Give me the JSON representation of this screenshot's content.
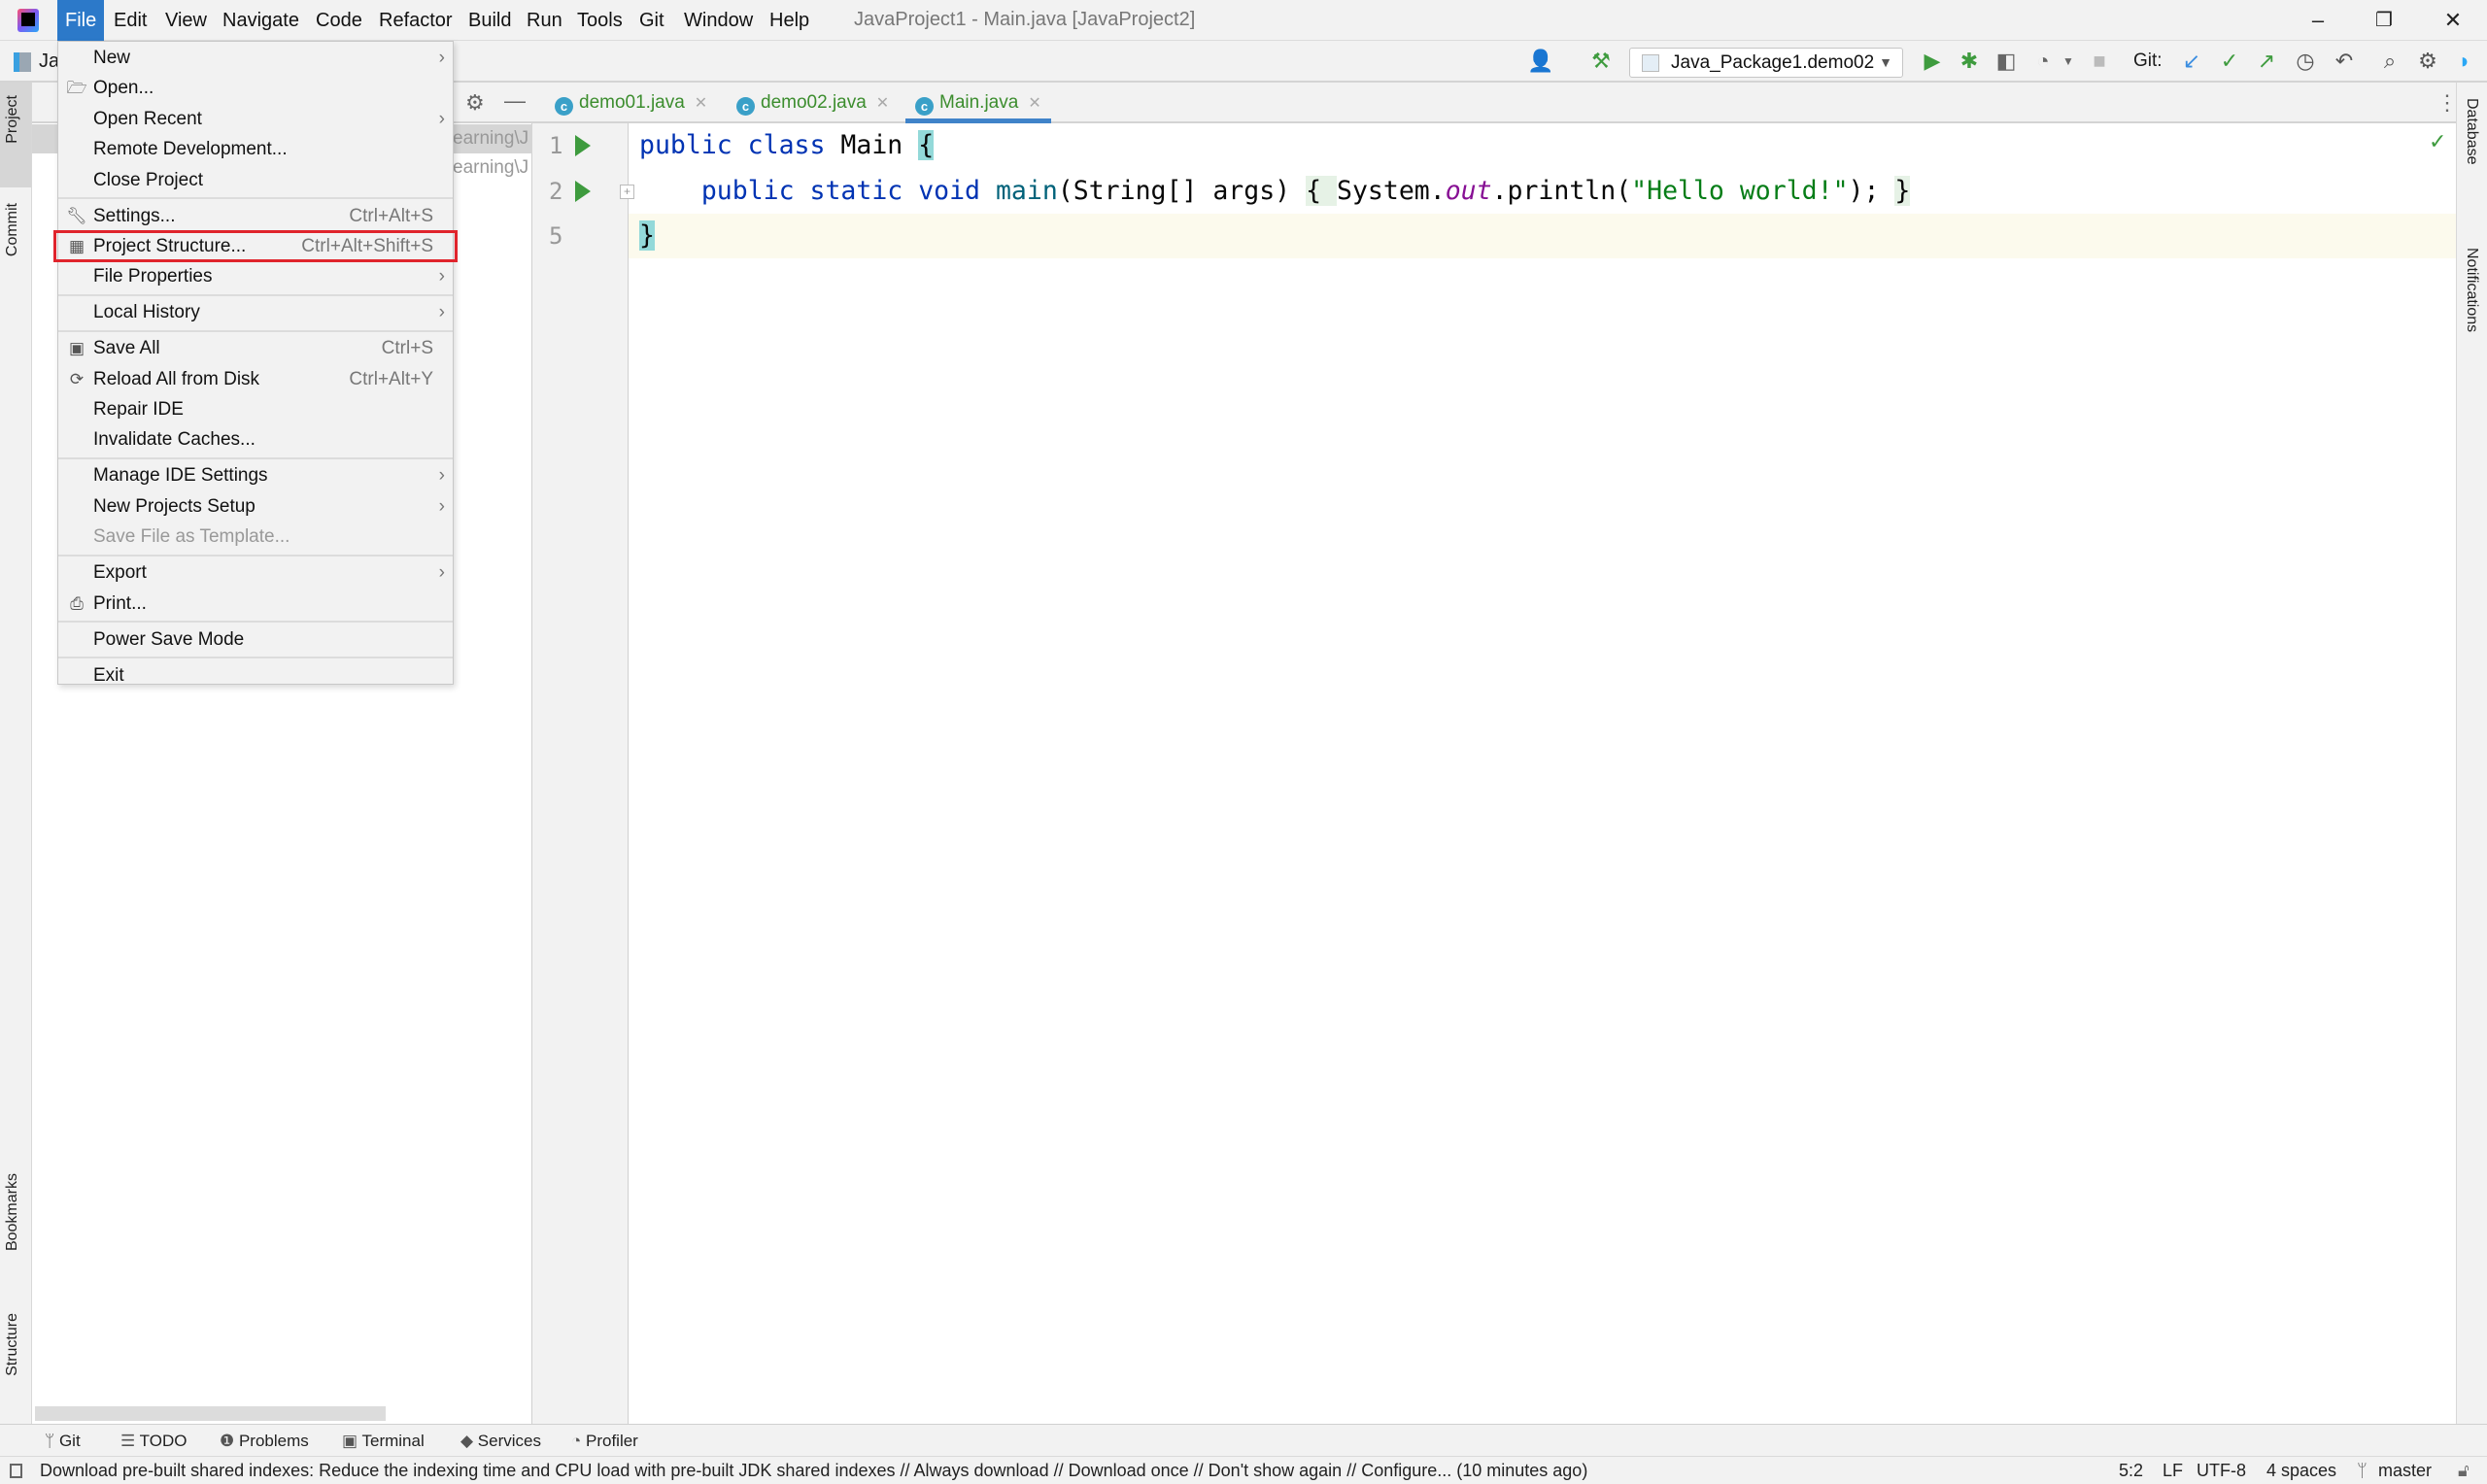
{
  "app": {
    "title": "JavaProject1 - Main.java [JavaProject2]",
    "logo_text": "IJ"
  },
  "menubar": [
    "File",
    "Edit",
    "View",
    "Navigate",
    "Code",
    "Refactor",
    "Build",
    "Run",
    "Tools",
    "Git",
    "Window",
    "Help"
  ],
  "window_controls": {
    "minimize": "–",
    "restore": "❐",
    "close": "✕"
  },
  "toolbar": {
    "project_label": "Ja",
    "run_config": "Java_Package1.demo02",
    "git_label": "Git:",
    "icons": [
      "user-icon",
      "hammer-icon",
      "run-icon",
      "debug-icon",
      "coverage-icon",
      "profile-icon",
      "stop-icon",
      "git-update-icon",
      "git-commit-icon",
      "git-push-icon",
      "history-icon",
      "rollback-icon",
      "search-icon",
      "settings-icon",
      "plugin-icon"
    ]
  },
  "left_stripe": [
    "Project",
    "Commit",
    "Bookmarks",
    "Structure"
  ],
  "right_stripe": [
    "Database",
    "Notifications"
  ],
  "project_panel": {
    "rows": [
      "earning\\J",
      "earning\\J"
    ]
  },
  "tabs": [
    {
      "label": "demo01.java",
      "active": false
    },
    {
      "label": "demo02.java",
      "active": false
    },
    {
      "label": "Main.java",
      "active": true
    }
  ],
  "colors": {
    "accent": "#2c79c9",
    "tab_text": "#3c8d2e",
    "keyword": "#0033b3",
    "string": "#067d17",
    "highlight_box": "#e0242c"
  },
  "code": [
    {
      "num": "1",
      "run": true,
      "tokens": [
        {
          "t": "public class ",
          "c": "kw"
        },
        {
          "t": "Main ",
          "c": ""
        },
        {
          "t": "{",
          "c": "hlc"
        }
      ]
    },
    {
      "num": "2",
      "run": true,
      "tokens": [
        {
          "t": "    ",
          "c": ""
        },
        {
          "t": "public static void ",
          "c": "kw"
        },
        {
          "t": "main",
          "c": "fn"
        },
        {
          "t": "(String[] args) ",
          "c": ""
        },
        {
          "t": "{ ",
          "c": "hlf"
        },
        {
          "t": "System.",
          "c": ""
        },
        {
          "t": "out",
          "c": "it"
        },
        {
          "t": ".println(",
          "c": ""
        },
        {
          "t": "\"Hello world!\"",
          "c": "st"
        },
        {
          "t": "); ",
          "c": ""
        },
        {
          "t": "}",
          "c": "hlf"
        }
      ]
    },
    {
      "num": "5",
      "run": false,
      "tokens": [
        {
          "t": "}",
          "c": "hlc"
        }
      ]
    }
  ],
  "file_menu": [
    {
      "label": "New",
      "submenu": true
    },
    {
      "label": "Open...",
      "icon": "folder-icon"
    },
    {
      "label": "Open Recent",
      "submenu": true
    },
    {
      "label": "Remote Development..."
    },
    {
      "label": "Close Project"
    },
    {
      "sep": true
    },
    {
      "label": "Settings...",
      "shortcut": "Ctrl+Alt+S",
      "icon": "wrench-icon"
    },
    {
      "label": "Project Structure...",
      "shortcut": "Ctrl+Alt+Shift+S",
      "icon": "project-structure-icon",
      "highlighted": true
    },
    {
      "label": "File Properties",
      "submenu": true
    },
    {
      "sep": true
    },
    {
      "label": "Local History",
      "submenu": true
    },
    {
      "sep": true
    },
    {
      "label": "Save All",
      "shortcut": "Ctrl+S",
      "icon": "save-icon"
    },
    {
      "label": "Reload All from Disk",
      "shortcut": "Ctrl+Alt+Y",
      "icon": "reload-icon"
    },
    {
      "label": "Repair IDE"
    },
    {
      "label": "Invalidate Caches..."
    },
    {
      "sep": true
    },
    {
      "label": "Manage IDE Settings",
      "submenu": true
    },
    {
      "label": "New Projects Setup",
      "submenu": true
    },
    {
      "label": "Save File as Template...",
      "disabled": true
    },
    {
      "sep": true
    },
    {
      "label": "Export",
      "submenu": true
    },
    {
      "label": "Print...",
      "icon": "printer-icon"
    },
    {
      "sep": true
    },
    {
      "label": "Power Save Mode"
    },
    {
      "sep": true
    },
    {
      "label": "Exit"
    }
  ],
  "bottom_tools": [
    "Git",
    "TODO",
    "Problems",
    "Terminal",
    "Services",
    "Profiler"
  ],
  "status": {
    "message": "Download pre-built shared indexes: Reduce the indexing time and CPU load with pre-built JDK shared indexes // Always download // Download once // Don't show again // Configure... (10 minutes ago)",
    "position": "5:2",
    "line_sep": "LF",
    "encoding": "UTF-8",
    "indent": "4 spaces",
    "branch": "master"
  }
}
